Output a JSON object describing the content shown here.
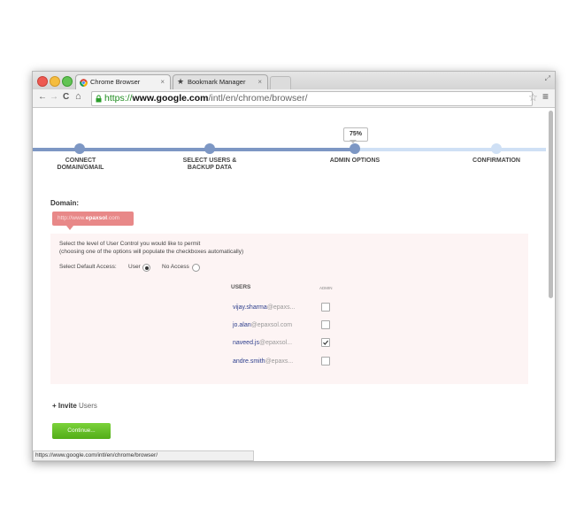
{
  "tabs": [
    {
      "label": "Chrome Browser",
      "active": true
    },
    {
      "label": "Bookmark Manager",
      "active": false
    }
  ],
  "tab_close_glyph": "×",
  "toolbar": {
    "back_glyph": "←",
    "forward_glyph": "→",
    "reload_glyph": "C",
    "home_glyph": "⌂",
    "url_scheme": "https://",
    "url_host": "www.google.com",
    "url_path": "/intl/en/chrome/browser/",
    "star_glyph": "☆",
    "menu_glyph": "≡",
    "window_resize_glyph": "⤢"
  },
  "progress": {
    "percent_label": "75%",
    "fraction": 0.75,
    "steps": [
      {
        "line1": "CONNECT",
        "line2": "DOMAIN/GMAIL"
      },
      {
        "line1": "SELECT USERS &",
        "line2": "BACKUP DATA"
      },
      {
        "line1": "ADMIN OPTIONS",
        "line2": ""
      },
      {
        "line1": "CONFIRMATION",
        "line2": ""
      }
    ]
  },
  "domain": {
    "label": "Domain:",
    "badge_prefix": "http://www.",
    "badge_domain": "epaxsol",
    "badge_suffix": ".com"
  },
  "panel": {
    "intro_line1": "Select the level of User Control you would like to permit",
    "intro_line2": "(choosing one of the options will populate the checkboxes automatically)",
    "default_access_label": "Select Default Access:",
    "option_user": "User",
    "option_no_access": "No Access",
    "selected_option": "User",
    "col_users": "USERS",
    "col_admin": "ADMIN",
    "users": [
      {
        "name": "vijay.sharma",
        "domain": "@epaxs...",
        "admin": false
      },
      {
        "name": "jo.alan",
        "domain": "@epaxsol.com",
        "admin": false
      },
      {
        "name": "naveed.js",
        "domain": "@epaxsol...",
        "admin": true
      },
      {
        "name": "andre.smith",
        "domain": "@epaxs...",
        "admin": false
      }
    ]
  },
  "invite": {
    "plus": "+ Invite",
    "rest": " Users"
  },
  "continue_label": "Continue...",
  "status_url": "https://www.google.com/intl/en/chrome/browser/",
  "colors": {
    "accent": "#7a9ad0",
    "track_done": "#7d97c4",
    "track_pending": "#cfe0f5",
    "badge": "#e88888",
    "continue": "#5fbe22",
    "url_green": "#1f8c1f"
  }
}
